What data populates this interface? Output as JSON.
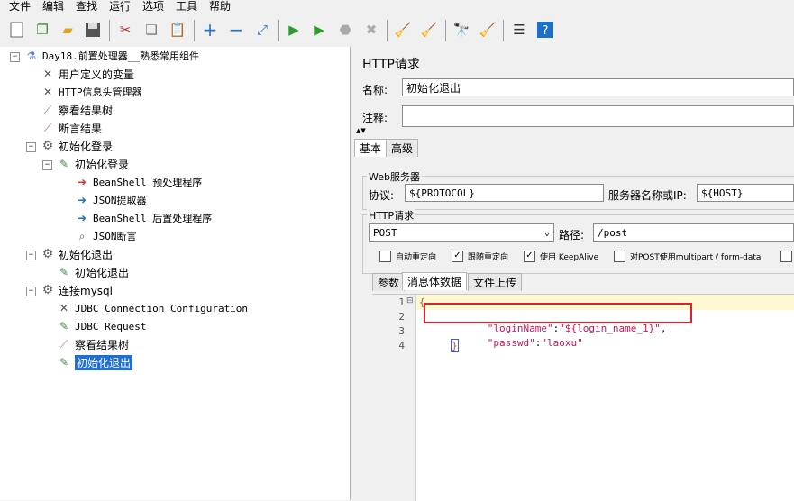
{
  "menu": [
    "文件",
    "编辑",
    "查找",
    "运行",
    "选项",
    "工具",
    "帮助"
  ],
  "toolbar_icons": [
    "new-icon",
    "template-icon",
    "open-icon",
    "save-icon",
    "cut-icon",
    "copy-icon",
    "paste-icon",
    "expand-icon",
    "collapse-icon",
    "toggle-icon",
    "start-icon",
    "start-no-pause-icon",
    "stop-icon",
    "shutdown-icon",
    "clear-icon",
    "clear-all-icon",
    "search-icon",
    "reset-search-icon",
    "function-helper-icon",
    "help-icon"
  ],
  "tree": {
    "root": "Day18.前置处理器__熟悉常用组件",
    "items": [
      "用户定义的变量",
      "HTTP信息头管理器",
      "察看结果树",
      "断言结果",
      "初始化登录",
      "初始化登录",
      "BeanShell 预处理程序",
      "JSON提取器",
      "BeanShell 后置处理程序",
      "JSON断言",
      "初始化退出",
      "初始化退出",
      "连接mysql",
      "JDBC Connection Configuration",
      "JDBC Request",
      "察看结果树",
      "初始化退出"
    ]
  },
  "panel": {
    "title": "HTTP请求",
    "name_label": "名称:",
    "name_value": "初始化退出",
    "comment_label": "注释:",
    "comment_value": "",
    "tabs": [
      "基本",
      "高级"
    ],
    "web_server_title": "Web服务器",
    "protocol_label": "协议:",
    "protocol_value": "${PROTOCOL}",
    "server_label": "服务器名称或IP:",
    "server_value": "${HOST}",
    "http_request_title": "HTTP请求",
    "method": "POST",
    "path_label": "路径:",
    "path_value": "/post",
    "checkboxes": [
      {
        "label": "自动重定向",
        "checked": false
      },
      {
        "label": "跟随重定向",
        "checked": true
      },
      {
        "label": "使用 KeepAlive",
        "checked": true
      },
      {
        "label": "对POST使用multipart / form-data",
        "checked": false
      }
    ],
    "body_tabs": [
      "参数",
      "消息体数据",
      "文件上传"
    ]
  },
  "editor": {
    "line_numbers": [
      "1",
      "2",
      "3",
      "4"
    ],
    "fold_marker": "⊟",
    "line1": "{",
    "line2_key": "\"loginName\"",
    "line2_sep": ":",
    "line2_val": "\"${login_name_1}\"",
    "line2_end": ",",
    "line3_key": "\"passwd\"",
    "line3_sep": ":",
    "line3_val": "\"laoxu\"",
    "line4": "}"
  },
  "colors": {
    "highlight_box": "#e0202e",
    "selection": "#1f6fd0",
    "json_string": "#c2185b"
  }
}
